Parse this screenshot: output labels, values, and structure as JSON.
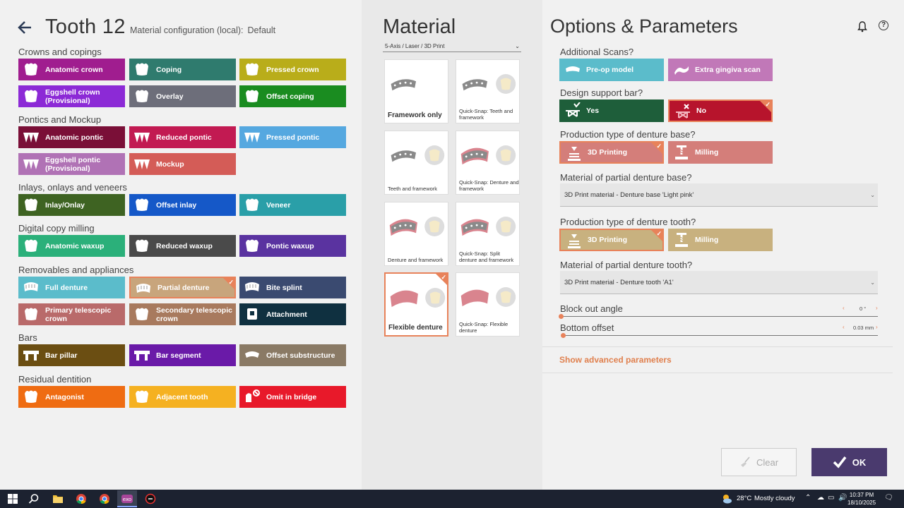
{
  "header": {
    "title": "Tooth 12",
    "config_label": "Material configuration (local):",
    "config_value": "Default"
  },
  "colors": {
    "accent": "#e8825a",
    "ok": "#4a3a6e"
  },
  "categories": [
    {
      "name": "Crowns and copings",
      "buttons": [
        {
          "label": "Anatomic crown",
          "color": "#a01d8f",
          "icon": "crown-icon"
        },
        {
          "label": "Coping",
          "color": "#2f7b6e",
          "icon": "coping-icon"
        },
        {
          "label": "Pressed crown",
          "color": "#b9ad1a",
          "icon": "pressed-crown-icon"
        },
        {
          "label": "Eggshell crown (Provisional)",
          "color": "#8c2ad6",
          "icon": "eggshell-crown-icon"
        },
        {
          "label": "Overlay",
          "color": "#6d6e7a",
          "icon": "overlay-icon"
        },
        {
          "label": "Offset coping",
          "color": "#1a8c20",
          "icon": "offset-coping-icon"
        }
      ]
    },
    {
      "name": "Pontics and Mockup",
      "buttons": [
        {
          "label": "Anatomic pontic",
          "color": "#7a0f37",
          "icon": "pontic-icon"
        },
        {
          "label": "Reduced pontic",
          "color": "#c21a52",
          "icon": "reduced-pontic-icon"
        },
        {
          "label": "Pressed pontic",
          "color": "#55a8e0",
          "icon": "pressed-pontic-icon"
        },
        {
          "label": "Eggshell pontic (Provisional)",
          "color": "#b072b5",
          "icon": "eggshell-pontic-icon"
        },
        {
          "label": "Mockup",
          "color": "#d45c57",
          "icon": "mockup-icon"
        }
      ]
    },
    {
      "name": "Inlays, onlays and veneers",
      "buttons": [
        {
          "label": "Inlay/Onlay",
          "color": "#3e6322",
          "icon": "inlay-icon"
        },
        {
          "label": "Offset inlay",
          "color": "#1558c8",
          "icon": "offset-inlay-icon"
        },
        {
          "label": "Veneer",
          "color": "#2a9fa8",
          "icon": "veneer-icon"
        }
      ]
    },
    {
      "name": "Digital copy milling",
      "buttons": [
        {
          "label": "Anatomic waxup",
          "color": "#2bb07a",
          "icon": "waxup-icon"
        },
        {
          "label": "Reduced waxup",
          "color": "#4a4a4a",
          "icon": "reduced-waxup-icon"
        },
        {
          "label": "Pontic waxup",
          "color": "#5a33a0",
          "icon": "pontic-waxup-icon"
        }
      ]
    },
    {
      "name": "Removables and appliances",
      "buttons": [
        {
          "label": "Full denture",
          "color": "#5bbccb",
          "icon": "full-denture-icon"
        },
        {
          "label": "Partial denture",
          "color": "#c8a57c",
          "icon": "partial-denture-icon",
          "selected": true
        },
        {
          "label": "Bite splint",
          "color": "#3a4a70",
          "icon": "bite-splint-icon"
        },
        {
          "label": "Primary telescopic crown",
          "color": "#b96a6a",
          "icon": "primary-telescopic-icon"
        },
        {
          "label": "Secondary telescopic crown",
          "color": "#a87a5e",
          "icon": "secondary-telescopic-icon"
        },
        {
          "label": "Attachment",
          "color": "#0f3040",
          "icon": "attachment-icon"
        }
      ]
    },
    {
      "name": "Bars",
      "buttons": [
        {
          "label": "Bar pillar",
          "color": "#6b4e12",
          "icon": "bar-pillar-icon"
        },
        {
          "label": "Bar segment",
          "color": "#6a1aa8",
          "icon": "bar-segment-icon"
        },
        {
          "label": "Offset substructure",
          "color": "#8a7a65",
          "icon": "offset-substructure-icon"
        }
      ]
    },
    {
      "name": "Residual dentition",
      "buttons": [
        {
          "label": "Antagonist",
          "color": "#ef6c12",
          "icon": "antagonist-icon"
        },
        {
          "label": "Adjacent tooth",
          "color": "#f5b121",
          "icon": "adjacent-tooth-icon"
        },
        {
          "label": "Omit in bridge",
          "color": "#e8192a",
          "icon": "omit-icon"
        }
      ]
    }
  ],
  "material": {
    "title": "Material",
    "select": "5-Axis / Laser / 3D Print",
    "cards": [
      {
        "label": "Framework only",
        "big": true
      },
      {
        "label": "Quick-Snap: Teeth and framework"
      },
      {
        "label": "Teeth and framework"
      },
      {
        "label": "Quick-Snap: Denture and framework"
      },
      {
        "label": "Denture and framework"
      },
      {
        "label": "Quick-Snap: Split denture and framework"
      },
      {
        "label": "Flexible denture",
        "big": true,
        "selected": true
      },
      {
        "label": "Quick-Snap: Flexible denture"
      }
    ]
  },
  "options": {
    "title": "Options & Parameters",
    "q1": "Additional Scans?",
    "scan_preop": "Pre-op model",
    "scan_gingiva": "Extra gingiva scan",
    "q2": "Design support bar?",
    "yes": "Yes",
    "no": "No",
    "q3": "Production type of denture base?",
    "print1": "3D Printing",
    "mill1": "Milling",
    "q4": "Material of partial denture base?",
    "dd1": "3D Print material - Denture base 'Light pink'",
    "q5": "Production type of denture tooth?",
    "print2": "3D Printing",
    "mill2": "Milling",
    "q6": "Material of partial denture tooth?",
    "dd2": "3D Print material - Denture tooth 'A1'",
    "s1": "Block out angle",
    "s1v": "0 °",
    "s2": "Bottom offset",
    "s2v": "0.03 mm",
    "advanced": "Show advanced parameters",
    "clear": "Clear",
    "ok": "OK"
  },
  "taskbar": {
    "weather": "28°C",
    "weather_desc": "Mostly cloudy",
    "time": "10:37 PM",
    "date": "18/10/2025"
  }
}
